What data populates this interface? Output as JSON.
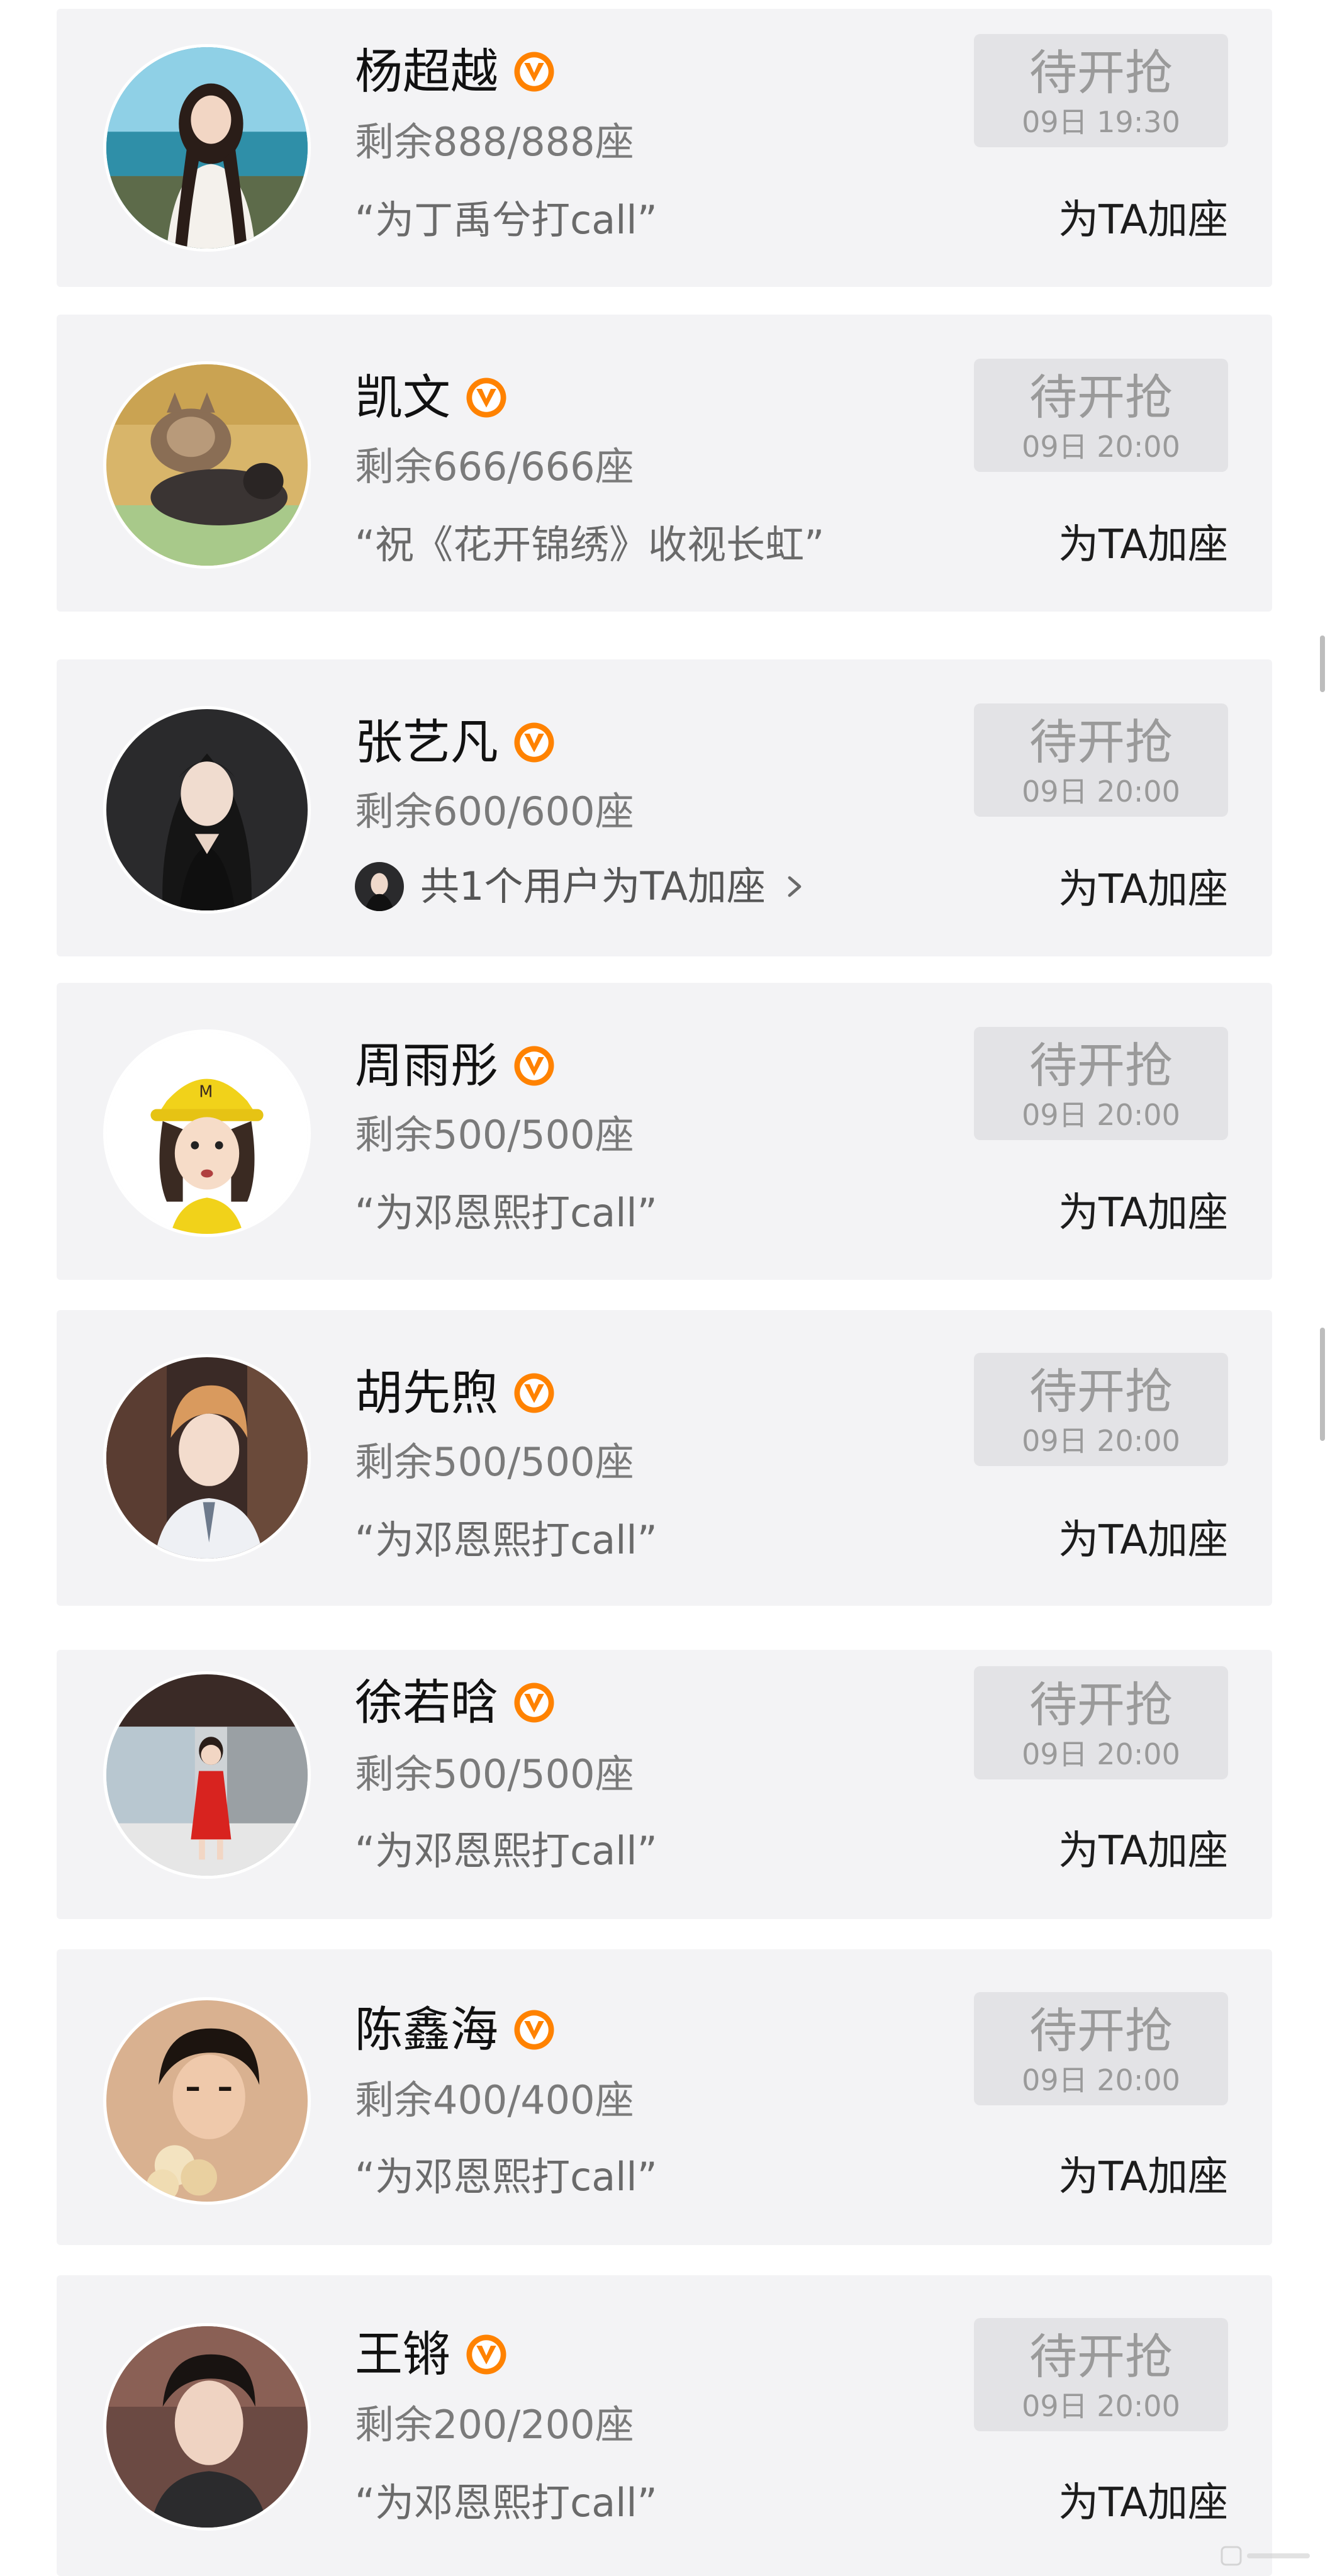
{
  "colors": {
    "card_bg": "#f3f3f5",
    "button_bg": "#e3e3e6",
    "button_text": "#9a9a9a",
    "verified_orange": "#ff8200",
    "seats_text": "#7a7a7a"
  },
  "icons": {
    "verified": "verified-v-icon",
    "chevron": "chevron-right-icon"
  },
  "items": [
    {
      "name": "杨超越",
      "seats": "剩余888/888座",
      "slogan": "“为丁禹兮打call”",
      "button_label": "待开抢",
      "button_time": "09日 19:30",
      "add_label": "为TA加座"
    },
    {
      "name": "凯文",
      "seats": "剩余666/666座",
      "slogan": "“祝《花开锦绣》收视长虹”",
      "button_label": "待开抢",
      "button_time": "09日 20:00",
      "add_label": "为TA加座"
    },
    {
      "name": "张艺凡",
      "seats": "剩余600/600座",
      "supporters_text": "共1个用户为TA加座",
      "button_label": "待开抢",
      "button_time": "09日 20:00",
      "add_label": "为TA加座"
    },
    {
      "name": "周雨彤",
      "seats": "剩余500/500座",
      "slogan": "“为邓恩熙打call”",
      "button_label": "待开抢",
      "button_time": "09日 20:00",
      "add_label": "为TA加座"
    },
    {
      "name": "胡先煦",
      "seats": "剩余500/500座",
      "slogan": "“为邓恩熙打call”",
      "button_label": "待开抢",
      "button_time": "09日 20:00",
      "add_label": "为TA加座"
    },
    {
      "name": "徐若晗",
      "seats": "剩余500/500座",
      "slogan": "“为邓恩熙打call”",
      "button_label": "待开抢",
      "button_time": "09日 20:00",
      "add_label": "为TA加座"
    },
    {
      "name": "陈鑫海",
      "seats": "剩余400/400座",
      "slogan": "“为邓恩熙打call”",
      "button_label": "待开抢",
      "button_time": "09日 20:00",
      "add_label": "为TA加座"
    },
    {
      "name": "王锵",
      "seats": "剩余200/200座",
      "slogan": "“为邓恩熙打call”",
      "button_label": "待开抢",
      "button_time": "09日 20:00",
      "add_label": "为TA加座"
    }
  ]
}
